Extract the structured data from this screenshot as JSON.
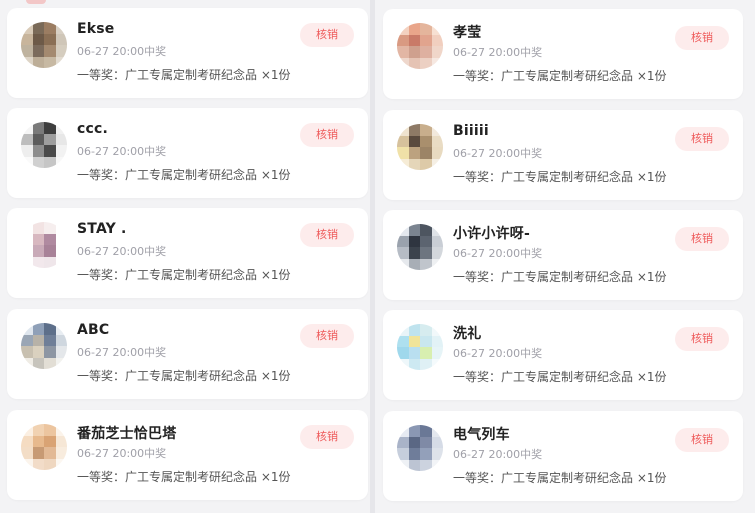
{
  "left_column": [
    {
      "name": "Ekse",
      "time": "06-27 20:00中奖",
      "prize": "一等奖：广工专属定制考研纪念品 ×1份",
      "action": "核销",
      "avatar_colors": [
        "#d9cbb8",
        "#7a6a58",
        "#9b7d62",
        "#d8d0c4",
        "#c8b59c",
        "#6d5a48",
        "#8a6f55",
        "#cfc6b8",
        "#bfb39f",
        "#7b6b5c",
        "#a48a70",
        "#d5cdbf",
        "#ddd4c6",
        "#bdae98",
        "#c7b9a3",
        "#e2dbd0"
      ]
    },
    {
      "name": "ccc.",
      "time": "06-27 20:00中奖",
      "prize": "一等奖：广工专属定制考研纪念品 ×1份",
      "action": "核销",
      "avatar_colors": [
        "#f5f5f5",
        "#7a7a7a",
        "#3e3e3e",
        "#f0f0f0",
        "#bdbdbd",
        "#5c5c5c",
        "#9e9e9e",
        "#e7e7e7",
        "#eeeeee",
        "#8d8d8d",
        "#4a4a4a",
        "#f2f2f2",
        "#fafafa",
        "#d0d0d0",
        "#c6c6c6",
        "#f8f8f8"
      ]
    },
    {
      "name": "STAY .",
      "time": "06-27 20:00中奖",
      "prize": "一等奖：广工专属定制考研纪念品 ×1份",
      "action": "核销",
      "avatar_colors": [
        "#ffffff",
        "#f2e3e3",
        "#f6eeee",
        "#ffffff",
        "#ffffff",
        "#d8b8c0",
        "#b08aa0",
        "#ffffff",
        "#ffffff",
        "#c9aab8",
        "#a88298",
        "#ffffff",
        "#ffffff",
        "#f2e8ec",
        "#efe6ea",
        "#ffffff"
      ]
    },
    {
      "name": "ABC",
      "time": "06-27 20:00中奖",
      "prize": "一等奖：广工专属定制考研纪念品 ×1份",
      "action": "核销",
      "avatar_colors": [
        "#dfe6ee",
        "#8fa0b8",
        "#5d6f8a",
        "#e8edf2",
        "#9aa6b5",
        "#b7b2a8",
        "#6f7f98",
        "#cfd7df",
        "#c8c0b0",
        "#dad1bf",
        "#8d96a3",
        "#e4e7ea",
        "#efece5",
        "#c7c4bc",
        "#e2ded5",
        "#f2f2ef"
      ]
    },
    {
      "name": "番茄芝士恰巴塔",
      "time": "06-27 20:00中奖",
      "prize": "一等奖：广工专属定制考研纪念品 ×1份",
      "action": "核销",
      "avatar_colors": [
        "#fbefe2",
        "#f1d2b2",
        "#ecc59f",
        "#fbf3ea",
        "#f5dcc2",
        "#e7b98d",
        "#d9a374",
        "#f6e7d6",
        "#f3ddc6",
        "#c79a74",
        "#e2b995",
        "#f8ecde",
        "#fbf4ec",
        "#f2dcc8",
        "#efd7c0",
        "#fcf7f1"
      ]
    }
  ],
  "right_column": [
    {
      "name": "孝莹",
      "time": "06-27 20:00中奖",
      "prize": "一等奖：广工专属定制考研纪念品 ×1份",
      "action": "核销",
      "avatar_colors": [
        "#f3d1c0",
        "#e9a58a",
        "#e4b59c",
        "#f7e0d2",
        "#d99a82",
        "#c97a68",
        "#e1a48e",
        "#f1cfbf",
        "#e2b6a4",
        "#cfa08e",
        "#deb0a0",
        "#f0d6c9",
        "#eed7cc",
        "#e5c3b4",
        "#ecd0c3",
        "#f6e8e1"
      ]
    },
    {
      "name": "Biiiii",
      "time": "06-27 20:00中奖",
      "prize": "一等奖：广工专属定制考研纪念品 ×1份",
      "action": "核销",
      "avatar_colors": [
        "#efe3cf",
        "#8e7a66",
        "#c8ae8c",
        "#f2e9dc",
        "#d6c19c",
        "#5a4a3e",
        "#a98f6d",
        "#e9dcc4",
        "#f0e1a8",
        "#bca27f",
        "#9c8466",
        "#e8dac0",
        "#f6ecd6",
        "#e5d6b9",
        "#ddcaa8",
        "#f5efe4"
      ]
    },
    {
      "name": "小许小许呀-",
      "time": "06-27 20:00中奖",
      "prize": "一等奖：广工专属定制考研纪念品 ×1份",
      "action": "核销",
      "avatar_colors": [
        "#e4e8ee",
        "#7b8490",
        "#4d5560",
        "#dfe3e8",
        "#9aa2ad",
        "#2f3540",
        "#5c6470",
        "#c9ced5",
        "#b6bcc5",
        "#3c434d",
        "#6d7580",
        "#d3d7dc",
        "#e6e9ed",
        "#a8aeb6",
        "#c0c5cc",
        "#eef0f2"
      ]
    },
    {
      "name": "洗礼",
      "time": "06-27 20:00中奖",
      "prize": "一等奖：广工专属定制考研纪念品 ×1份",
      "action": "核销",
      "avatar_colors": [
        "#e8f4f8",
        "#bfe3ee",
        "#d6ecef",
        "#f1f8fa",
        "#aee0ef",
        "#f1e49a",
        "#c9e7ef",
        "#e2f2f6",
        "#9fd8ec",
        "#b9dff0",
        "#d8efb0",
        "#e6f4f7",
        "#eef7fa",
        "#cde9f2",
        "#dff0f5",
        "#f4fafc"
      ]
    },
    {
      "name": "电气列车",
      "time": "06-27 20:00中奖",
      "prize": "一等奖：广工专属定制考研纪念品 ×1份",
      "action": "核销",
      "avatar_colors": [
        "#e6eaf2",
        "#8a97b3",
        "#6a7896",
        "#e3e7ee",
        "#a9b3c8",
        "#5a6784",
        "#7f8aa6",
        "#d5dbe6",
        "#c6cedc",
        "#6f7d9a",
        "#93a0ba",
        "#dde2ea",
        "#eef1f5",
        "#bcc4d3",
        "#ccd3df",
        "#f2f4f7"
      ]
    }
  ]
}
